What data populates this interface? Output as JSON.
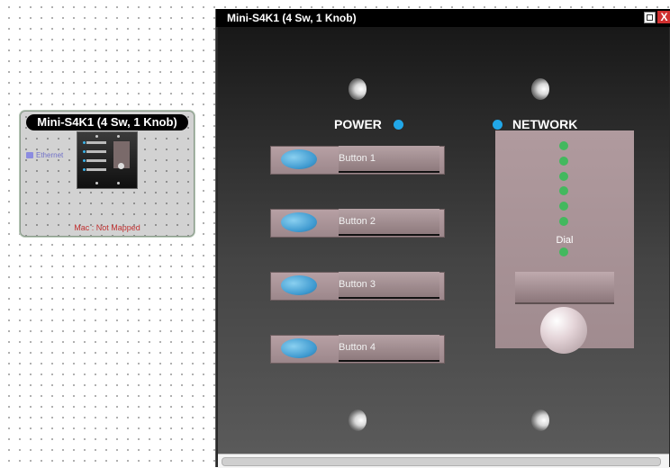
{
  "block": {
    "title": "Mini-S4K1 (4 Sw, 1 Knob)",
    "ethernet_label": "Ethernet",
    "mac_label": "Mac : Not Mapped"
  },
  "window": {
    "title": "Mini-S4K1 (4 Sw, 1 Knob)",
    "close_label": "X",
    "power_label": "POWER",
    "network_label": "NETWORK",
    "buttons": [
      {
        "label": "Button 1"
      },
      {
        "label": "Button 2"
      },
      {
        "label": "Button 3"
      },
      {
        "label": "Button 4"
      }
    ],
    "dial_label": "Dial"
  },
  "colors": {
    "indicator": "#21a7e8",
    "led_green": "#43b85e",
    "mac_text": "#c03030",
    "close_button": "#d03030"
  },
  "icons": [
    "ethernet-icon",
    "screw-icon",
    "restore-icon",
    "close-icon"
  ]
}
